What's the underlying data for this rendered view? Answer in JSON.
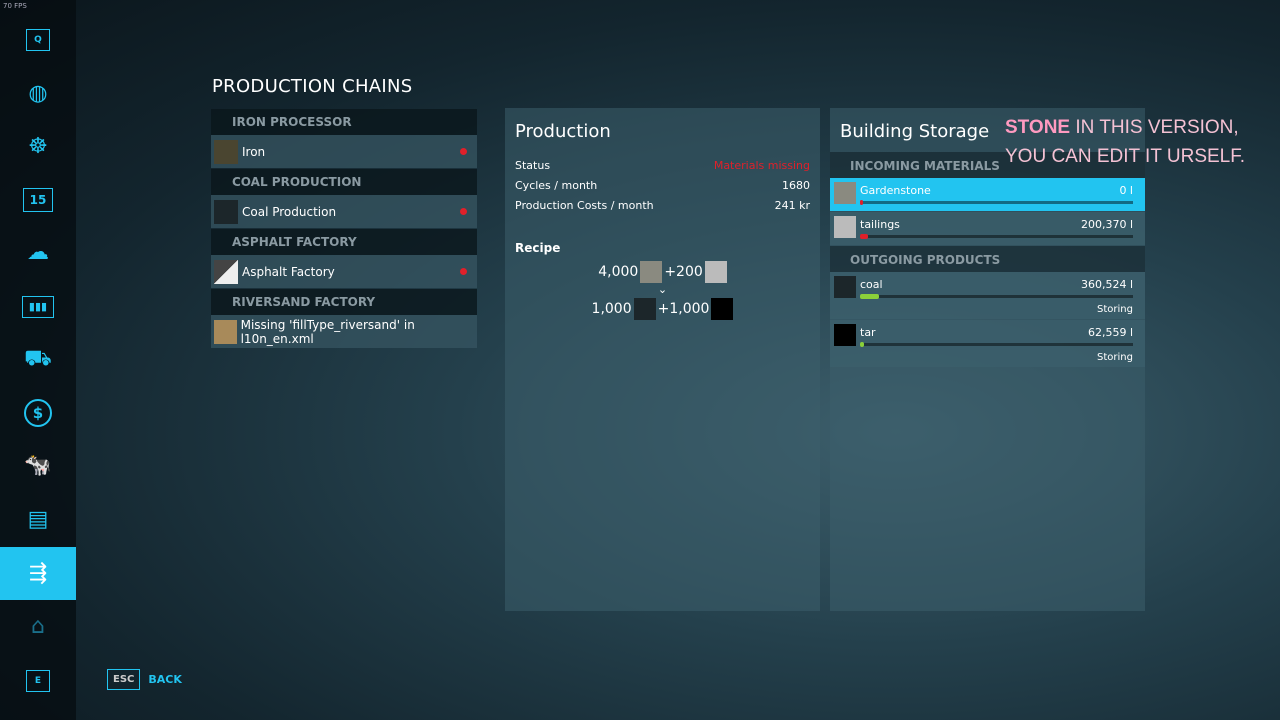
{
  "fps": "70 FPS",
  "sidebar": {
    "items": [
      {
        "name": "key-q",
        "label": "Q"
      },
      {
        "name": "map-icon",
        "glyph": "🌍"
      },
      {
        "name": "steering-wheel-icon",
        "glyph": "☸"
      },
      {
        "name": "calendar-icon",
        "label": "15"
      },
      {
        "name": "weather-icon",
        "glyph": "⛅"
      },
      {
        "name": "statistics-icon",
        "glyph": "📊"
      },
      {
        "name": "tractor-icon",
        "glyph": "🚜"
      },
      {
        "name": "finances-icon",
        "glyph": "$"
      },
      {
        "name": "animals-icon",
        "glyph": "🐄"
      },
      {
        "name": "contracts-icon",
        "glyph": "📰"
      },
      {
        "name": "production-icon",
        "glyph": "⇄",
        "active": true
      },
      {
        "name": "barn-icon",
        "glyph": "⌂"
      },
      {
        "name": "key-e",
        "label": "E"
      }
    ]
  },
  "back": {
    "key": "ESC",
    "label": "BACK"
  },
  "chains": {
    "title": "PRODUCTION CHAINS",
    "groups": [
      {
        "header": "IRON PROCESSOR",
        "item": "Iron"
      },
      {
        "header": "COAL PRODUCTION",
        "item": "Coal Production"
      },
      {
        "header": "ASPHALT FACTORY",
        "item": "Asphalt Factory"
      },
      {
        "header": "RIVERSAND FACTORY",
        "item": "Missing 'fillType_riversand' in l10n_en.xml"
      }
    ]
  },
  "production": {
    "title": "Production",
    "status_label": "Status",
    "status": "Materials missing",
    "cycles_label": "Cycles / month",
    "cycles": "1680",
    "costs_label": "Production Costs / month",
    "costs": "241 kr",
    "recipe_label": "Recipe",
    "in1": "4,000",
    "in2": "+200",
    "out1": "1,000",
    "out2": "+1,000"
  },
  "storage": {
    "title": "Building Storage",
    "incoming_label": "INCOMING MATERIALS",
    "outgoing_label": "OUTGOING PRODUCTS",
    "incoming": [
      {
        "name": "Gardenstone",
        "amount": "0 l",
        "fill": 0.01
      },
      {
        "name": "tailings",
        "amount": "200,370 l",
        "fill": 0.03
      }
    ],
    "outgoing": [
      {
        "name": "coal",
        "amount": "360,524 l",
        "fill": 0.07,
        "mode": "Storing"
      },
      {
        "name": "tar",
        "amount": "62,559 l",
        "fill": 0.01,
        "mode": "Storing"
      }
    ]
  },
  "note": {
    "bold": "STONE",
    "line1": " IN THIS VERSION,",
    "line2": "YOU CAN EDIT IT URSELF."
  },
  "colors": {
    "accent": "#22c4f0",
    "error": "#e0202a",
    "fill_ok": "#8bd13a"
  }
}
